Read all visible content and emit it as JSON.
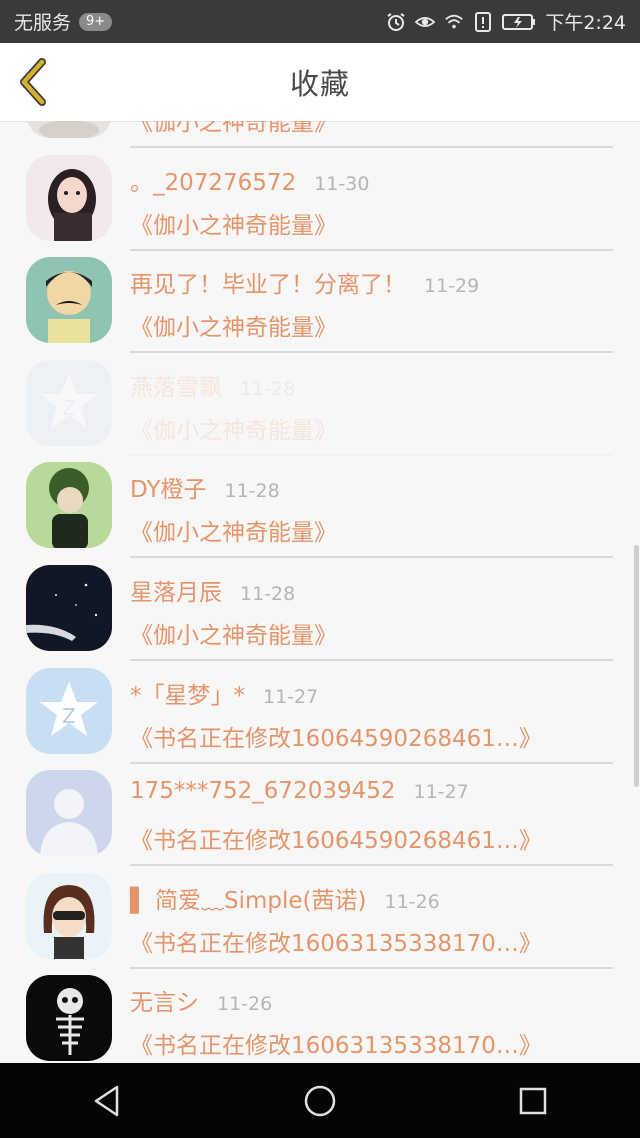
{
  "status_bar": {
    "carrier": "无服务",
    "notif_badge": "9+",
    "time": "下午2:24",
    "icons": [
      "alarm-icon",
      "eye-icon",
      "wifi-icon",
      "alert-icon",
      "battery-icon"
    ]
  },
  "header": {
    "title": "收藏",
    "back_icon": "chevron-left-icon",
    "accent_color": "#c9a020"
  },
  "list": {
    "name_color": "#e4956a",
    "items": [
      {
        "name": "",
        "time": "",
        "book": "《伽小之神奇能量》",
        "avatar": "partial-avatar"
      },
      {
        "name": "。_207276572",
        "time": "11-30",
        "book": "《伽小之神奇能量》",
        "avatar": "girl-avatar"
      },
      {
        "name": "再见了！毕业了！分离了！",
        "time": "11-29",
        "book": "《伽小之神奇能量》",
        "avatar": "mustache-boy-avatar"
      },
      {
        "name": "燕落雪飘",
        "time": "11-28",
        "book": "《伽小之神奇能量》",
        "avatar": "qzone-avatar"
      },
      {
        "name": "DY橙子",
        "time": "11-28",
        "book": "《伽小之神奇能量》",
        "avatar": "green-boy-avatar"
      },
      {
        "name": "星落月辰",
        "time": "11-28",
        "book": "《伽小之神奇能量》",
        "avatar": "night-sky-avatar"
      },
      {
        "name": "*「星梦」*",
        "time": "11-27",
        "book": "《书名正在修改16064590268461…》",
        "avatar": "qzone-avatar"
      },
      {
        "name": "175***752_672039452",
        "time": "11-27",
        "book": "《书名正在修改16064590268461…》",
        "avatar": "default-person-avatar"
      },
      {
        "name": "▌ 简爱﹏Simple(茜诺)",
        "time": "11-26",
        "book": "《书名正在修改16063135338170…》",
        "avatar": "cartoon-girl-avatar"
      },
      {
        "name": "无言シ",
        "time": "11-26",
        "book": "《书名正在修改16063135338170…》",
        "avatar": "skeleton-avatar"
      }
    ]
  },
  "nav_bar": {
    "icons": [
      "back-triangle-icon",
      "home-circle-icon",
      "recents-square-icon"
    ]
  }
}
